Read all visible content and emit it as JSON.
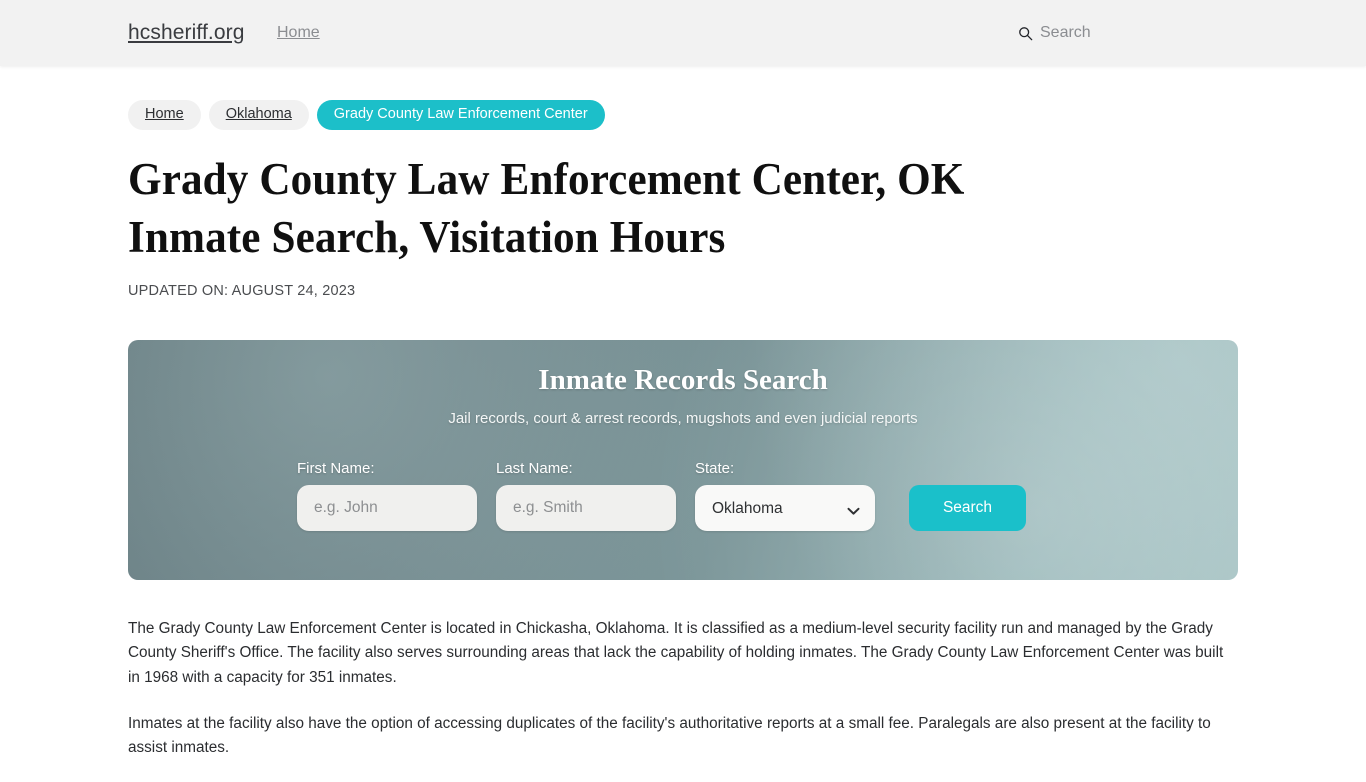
{
  "header": {
    "brand": "hcsheriff.org",
    "nav": [
      {
        "label": "Home"
      }
    ],
    "search": {
      "icon": "search-icon",
      "label": "Search"
    }
  },
  "breadcrumbs": [
    {
      "label": "Home",
      "active": false
    },
    {
      "label": "Oklahoma",
      "active": false
    },
    {
      "label": "Grady County Law Enforcement Center",
      "active": true
    }
  ],
  "article": {
    "title": "Grady County Law Enforcement Center, OK Inmate Search, Visitation Hours",
    "updated": "UPDATED ON: AUGUST 24, 2023",
    "paragraphs": [
      "The Grady County Law Enforcement Center is located in Chickasha, Oklahoma. It is classified as a medium-level security facility run and managed by the Grady County Sheriff's Office. The facility also serves surrounding areas that lack the capability of holding inmates. The Grady County Law Enforcement Center was built in 1968 with a capacity for 351 inmates.",
      "Inmates at the facility also have the option of accessing duplicates of the facility's authoritative reports at a small fee. Paralegals are also present at the facility to assist inmates."
    ]
  },
  "search_widget": {
    "title": "Inmate Records Search",
    "subtitle": "Jail records, court & arrest records, mugshots and even judicial reports",
    "fields": {
      "first_name": {
        "label": "First Name:",
        "placeholder": "e.g. John",
        "value": ""
      },
      "last_name": {
        "label": "Last Name:",
        "placeholder": "e.g. Smith",
        "value": ""
      },
      "state": {
        "label": "State:",
        "selected": "Oklahoma",
        "options": [
          "Oklahoma"
        ]
      }
    },
    "submit_label": "Search"
  },
  "colors": {
    "accent_teal": "#1ac0ca",
    "header_bg": "#f2f2f2",
    "crumb_bg": "#f1f1f1",
    "card_gradient_start": "#64797e",
    "card_gradient_end": "#9dbcbd",
    "input_bg": "#f0f0ee",
    "text_dark": "#2b2d30",
    "text_muted": "#8b8d91"
  }
}
